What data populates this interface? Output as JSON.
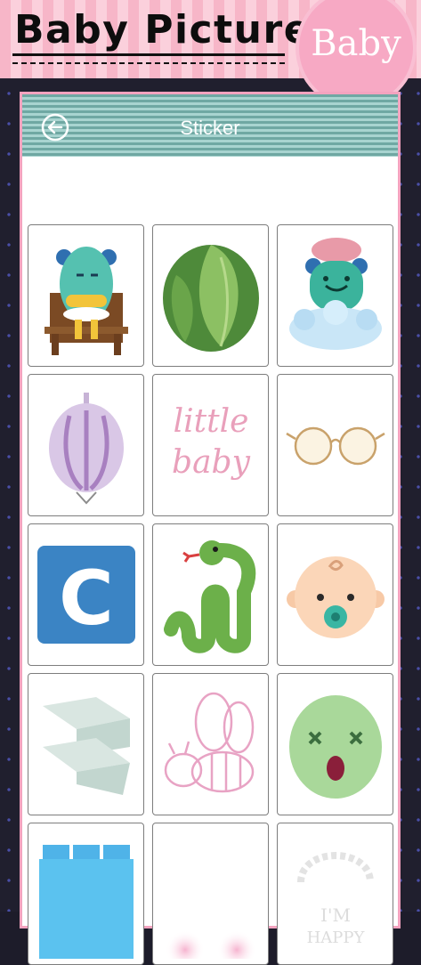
{
  "app": {
    "title": "Baby Picture",
    "badge": "Baby"
  },
  "header": {
    "title": "Sticker",
    "back_icon": "back-arrow-icon"
  },
  "colors": {
    "banner_pink": "#f7b6c8",
    "badge_pink": "#f7a9c4",
    "header_teal": "#6fa8a3",
    "frame_border": "#f3a3bf"
  },
  "stickers": [
    {
      "name": "monster-chair-sticker"
    },
    {
      "name": "cabbage-sticker"
    },
    {
      "name": "bath-monster-sticker"
    },
    {
      "name": "onion-sticker"
    },
    {
      "name": "little-baby-text-sticker",
      "text_line1": "little",
      "text_line2": "baby"
    },
    {
      "name": "glasses-sticker"
    },
    {
      "name": "letter-c-block-sticker",
      "letter": "C"
    },
    {
      "name": "snake-sticker"
    },
    {
      "name": "baby-face-pacifier-sticker"
    },
    {
      "name": "ribbon-sticker"
    },
    {
      "name": "bee-outline-sticker"
    },
    {
      "name": "green-face-sticker"
    },
    {
      "name": "blue-blocks-sticker"
    },
    {
      "name": "pink-cheeks-sticker"
    },
    {
      "name": "im-happy-sticker",
      "text_line1": "I'M",
      "text_line2": "HAPPY"
    }
  ]
}
